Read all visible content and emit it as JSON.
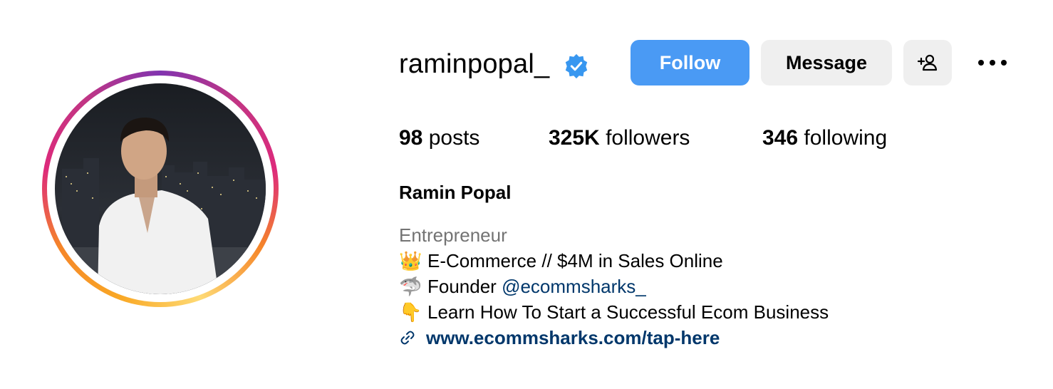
{
  "profile": {
    "username": "raminpopal_",
    "verified_icon": "verified-badge-icon",
    "buttons": {
      "follow": "Follow",
      "message": "Message",
      "add_user_icon": "add-user-icon",
      "more_icon": "more-options-icon"
    },
    "stats": {
      "posts_count": "98",
      "posts_label": "posts",
      "followers_count": "325K",
      "followers_label": "followers",
      "following_count": "346",
      "following_label": "following"
    },
    "full_name": "Ramin Popal",
    "category": "Entrepreneur",
    "bio": [
      {
        "emoji": "👑",
        "text": "E-Commerce // $4M in Sales Online"
      },
      {
        "emoji": "🦈",
        "text": "Founder ",
        "mention": "@ecommsharks_"
      },
      {
        "emoji": "👇",
        "text": "Learn How To Start a Successful Ecom Business"
      }
    ],
    "link": "www.ecommsharks.com/tap-here"
  },
  "colors": {
    "follow_button": "#4a9af4",
    "secondary_button": "#efefef",
    "link": "#00376b",
    "category": "#737373",
    "verified": "#3897f0"
  }
}
